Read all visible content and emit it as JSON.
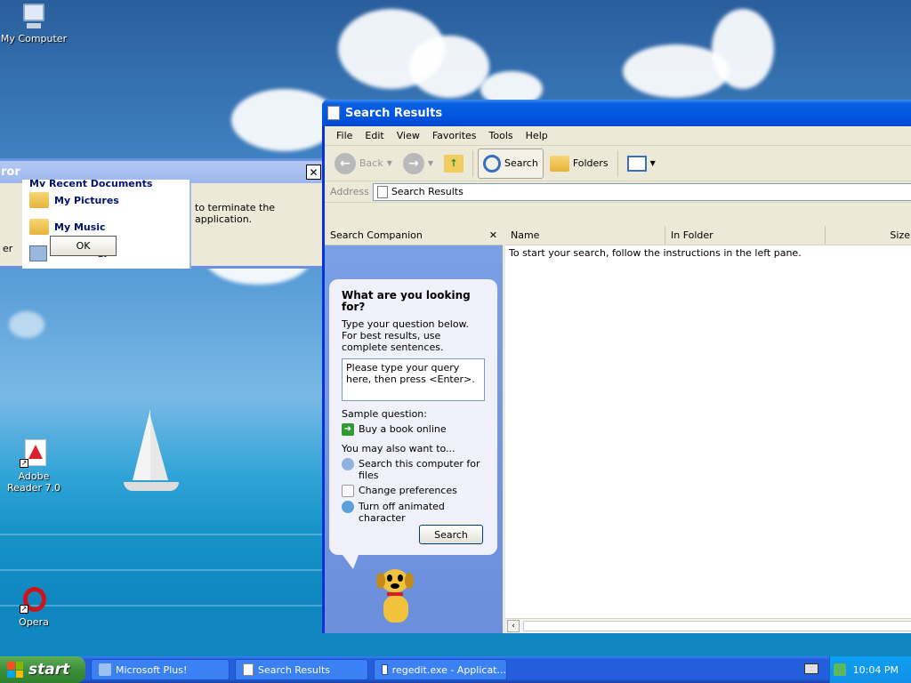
{
  "desktop": {
    "icons": [
      {
        "label": "My Computer",
        "icon": "my-computer-icon"
      },
      {
        "label": "Adobe Reader 7.0",
        "icon": "adobe-reader-icon"
      },
      {
        "label": "Opera",
        "icon": "opera-icon"
      }
    ]
  },
  "error_dialog": {
    "title_fragment": "ror",
    "message": "to terminate the application.",
    "ok_label": "OK",
    "close_label": "✕",
    "left_fragment": "er"
  },
  "start_menu_fragment": {
    "items": [
      {
        "label": "My Recent Documents",
        "icon": "recent-documents-icon"
      },
      {
        "label": "My Pictures",
        "icon": "folder-icon"
      },
      {
        "label": "My Music",
        "icon": "folder-icon"
      },
      {
        "label": "er",
        "icon": "computer-icon"
      }
    ]
  },
  "window": {
    "title": "Search Results",
    "menu": [
      "File",
      "Edit",
      "View",
      "Favorites",
      "Tools",
      "Help"
    ],
    "toolbar": {
      "back": "Back",
      "search": "Search",
      "folders": "Folders"
    },
    "address": {
      "label": "Address",
      "value": "Search Results"
    },
    "companion": {
      "header": "Search Companion",
      "close": "✕",
      "heading": "What are you looking for?",
      "instructions": "Type your question below. For best results, use complete sentences.",
      "query_placeholder": "Please type your query here, then press <Enter>.",
      "sample_label": "Sample question:",
      "sample_link": "Buy a book online",
      "also_label": "You may also want to...",
      "links": [
        {
          "label": "Search this computer for files",
          "icon": "search-computer-icon"
        },
        {
          "label": "Change preferences",
          "icon": "preferences-icon"
        },
        {
          "label": "Turn off animated character",
          "icon": "character-icon"
        }
      ],
      "search_button": "Search"
    },
    "results": {
      "columns": [
        "Name",
        "In Folder",
        "Size"
      ],
      "message": "To start your search, follow the instructions in the left pane."
    }
  },
  "taskbar": {
    "start_label": "start",
    "tasks": [
      {
        "label": "Microsoft Plus!",
        "icon": "plus-icon"
      },
      {
        "label": "Search Results",
        "icon": "search-window-icon"
      },
      {
        "label": "regedit.exe - Applicat...",
        "icon": "app-window-icon"
      }
    ],
    "clock": "10:04 PM"
  }
}
